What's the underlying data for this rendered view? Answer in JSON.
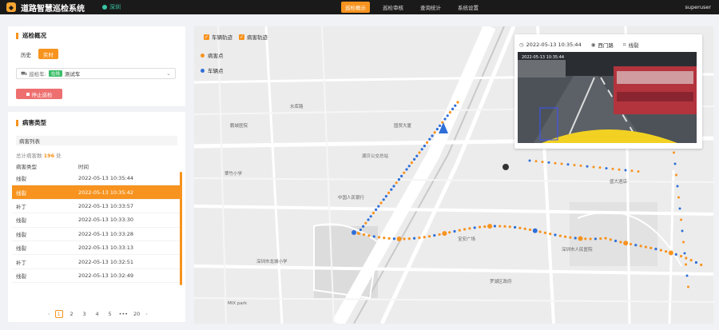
{
  "header": {
    "title": "道路智慧巡检系统",
    "city": "深圳",
    "nav": [
      "巡检概示",
      "巡检审核",
      "查询统计",
      "系统设置"
    ],
    "active_nav": 0,
    "user": "superuser"
  },
  "overview": {
    "title": "巡检概况",
    "tabs": [
      "历史",
      "实时"
    ],
    "active_tab": 1,
    "vehicle_label": "巡检车:",
    "vehicle_status": "在线",
    "vehicle_name": "测试车",
    "stop_button": "停止巡检"
  },
  "defects": {
    "title": "病害类型",
    "list_title": "病害列表",
    "total_label": "总计病害数",
    "total_count": "196",
    "total_unit": "处",
    "columns": [
      "病害类型",
      "时间"
    ],
    "rows": [
      {
        "type": "线裂",
        "time": "2022-05-13 10:35:44"
      },
      {
        "type": "线裂",
        "time": "2022-05-13 10:35:42"
      },
      {
        "type": "补丁",
        "time": "2022-05-13 10:33:57"
      },
      {
        "type": "线裂",
        "time": "2022-05-13 10:33:30"
      },
      {
        "type": "线裂",
        "time": "2022-05-13 10:33:28"
      },
      {
        "type": "线裂",
        "time": "2022-05-13 10:33:13"
      },
      {
        "type": "补丁",
        "time": "2022-05-13 10:32:51"
      },
      {
        "type": "线裂",
        "time": "2022-05-13 10:32:49"
      }
    ],
    "selected_row": 1,
    "pager": {
      "pages": [
        "1",
        "2",
        "3",
        "4",
        "5",
        "•••",
        "20"
      ],
      "current": "1"
    }
  },
  "map": {
    "toggles": [
      "车辆轨迹",
      "病害轨迹"
    ],
    "legend": [
      {
        "label": "病害点",
        "color": "#f7931e"
      },
      {
        "label": "车辆点",
        "color": "#2f6fd8"
      }
    ],
    "labels": [
      "湖贝公交总站",
      "鹏城医院",
      "翠竹小学",
      "水库路",
      "中国人民银行",
      "深圳市龙城小学",
      "宝安广场",
      "MIX park",
      "深圳市人民医院",
      "盛大酒店",
      "罗湖区政府",
      "国贸大厦"
    ],
    "popup": {
      "time": "2022-05-13 10:35:44",
      "road": "西门路",
      "defect": "线裂",
      "camera_stamp": "2022-05-13 10:35:44"
    }
  },
  "colors": {
    "accent": "#f7931e",
    "online": "#3bbf69",
    "danger": "#ee6f6f",
    "vehicle": "#2f6fd8"
  }
}
